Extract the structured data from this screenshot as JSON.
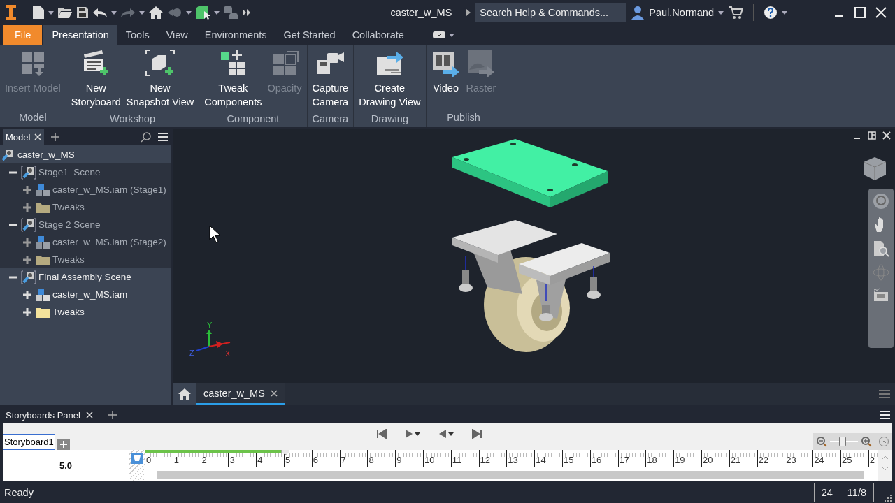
{
  "title_bar": {
    "document_title": "caster_w_MS",
    "search": {
      "placeholder": "Search Help & Commands..."
    },
    "user": "Paul.Normand"
  },
  "ribbon_tabs": [
    {
      "label": "File",
      "kind": "file"
    },
    {
      "label": "Presentation",
      "kind": "tab",
      "selected": true
    },
    {
      "label": "Tools",
      "kind": "tab",
      "selected": false
    },
    {
      "label": "View",
      "kind": "tab",
      "selected": false
    },
    {
      "label": "Environments",
      "kind": "tab",
      "selected": false
    },
    {
      "label": "Get Started",
      "kind": "tab",
      "selected": false
    },
    {
      "label": "Collaborate",
      "kind": "tab",
      "selected": false
    }
  ],
  "ribbon_groups": [
    {
      "title": "Model",
      "buttons": [
        {
          "label": "Insert Model",
          "kind": "insert-model",
          "disabled": true
        }
      ]
    },
    {
      "title": "Workshop",
      "buttons": [
        {
          "label": "New\nStoryboard",
          "kind": "new-storyboard",
          "disabled": false
        },
        {
          "label": "New\nSnapshot View",
          "kind": "new-snapshot",
          "disabled": false
        }
      ]
    },
    {
      "title": "Component",
      "buttons": [
        {
          "label": "Tweak\nComponents",
          "kind": "tweak",
          "disabled": false
        },
        {
          "label": "Opacity",
          "kind": "opacity",
          "disabled": true
        }
      ]
    },
    {
      "title": "Camera",
      "buttons": [
        {
          "label": "Capture\nCamera",
          "kind": "capture-camera",
          "disabled": false
        }
      ]
    },
    {
      "title": "Drawing",
      "buttons": [
        {
          "label": "Create\nDrawing View",
          "kind": "drawing-view",
          "disabled": false
        }
      ]
    },
    {
      "title": "Publish",
      "buttons": [
        {
          "label": "Video",
          "kind": "video",
          "disabled": false
        },
        {
          "label": "Raster",
          "kind": "raster",
          "disabled": true
        }
      ]
    }
  ],
  "browser": {
    "tabs": [
      {
        "label": "Model",
        "selected": true
      }
    ],
    "tree": {
      "label": "caster_w_MS",
      "kind": "presentation",
      "children": [
        {
          "label": "Stage1_Scene",
          "kind": "scene",
          "active": false,
          "expanded": true,
          "children": [
            {
              "label": "caster_w_MS.iam (Stage1)",
              "kind": "assembly",
              "expanded": false
            },
            {
              "label": "Tweaks",
              "kind": "folder",
              "expanded": false
            }
          ]
        },
        {
          "label": "Stage 2 Scene",
          "kind": "scene",
          "active": false,
          "expanded": true,
          "children": [
            {
              "label": "caster_w_MS.iam (Stage2)",
              "kind": "assembly",
              "expanded": false
            },
            {
              "label": "Tweaks",
              "kind": "folder",
              "expanded": false
            }
          ]
        },
        {
          "label": "Final Assembly Scene",
          "kind": "scene",
          "active": true,
          "expanded": true,
          "children": [
            {
              "label": "caster_w_MS.iam",
              "kind": "assembly",
              "expanded": false
            },
            {
              "label": "Tweaks",
              "kind": "folder",
              "expanded": false
            }
          ]
        }
      ]
    }
  },
  "viewport": {
    "axis_labels": [
      "Y",
      "Z",
      "X"
    ]
  },
  "document_tabs": [
    {
      "label": "caster_w_MS",
      "selected": true
    }
  ],
  "storyboard_panel": {
    "title": "Storyboards Panel",
    "storyboard_tabs": [
      {
        "label": "Storyboard1",
        "selected": true
      }
    ],
    "current_time": "5.0",
    "ruler_labels": [
      "0",
      "1",
      "2",
      "3",
      "4",
      "5",
      "6",
      "7",
      "8",
      "9",
      "10",
      "11",
      "12",
      "13",
      "14",
      "15",
      "16",
      "17",
      "18",
      "19",
      "20",
      "21",
      "22",
      "23",
      "24",
      "25",
      "2"
    ],
    "timeline": {
      "level": 0.192
    },
    "zoom": {
      "level": 0.45
    }
  },
  "status_bar": {
    "message": "Ready",
    "cells": [
      "24",
      "11/8"
    ]
  }
}
